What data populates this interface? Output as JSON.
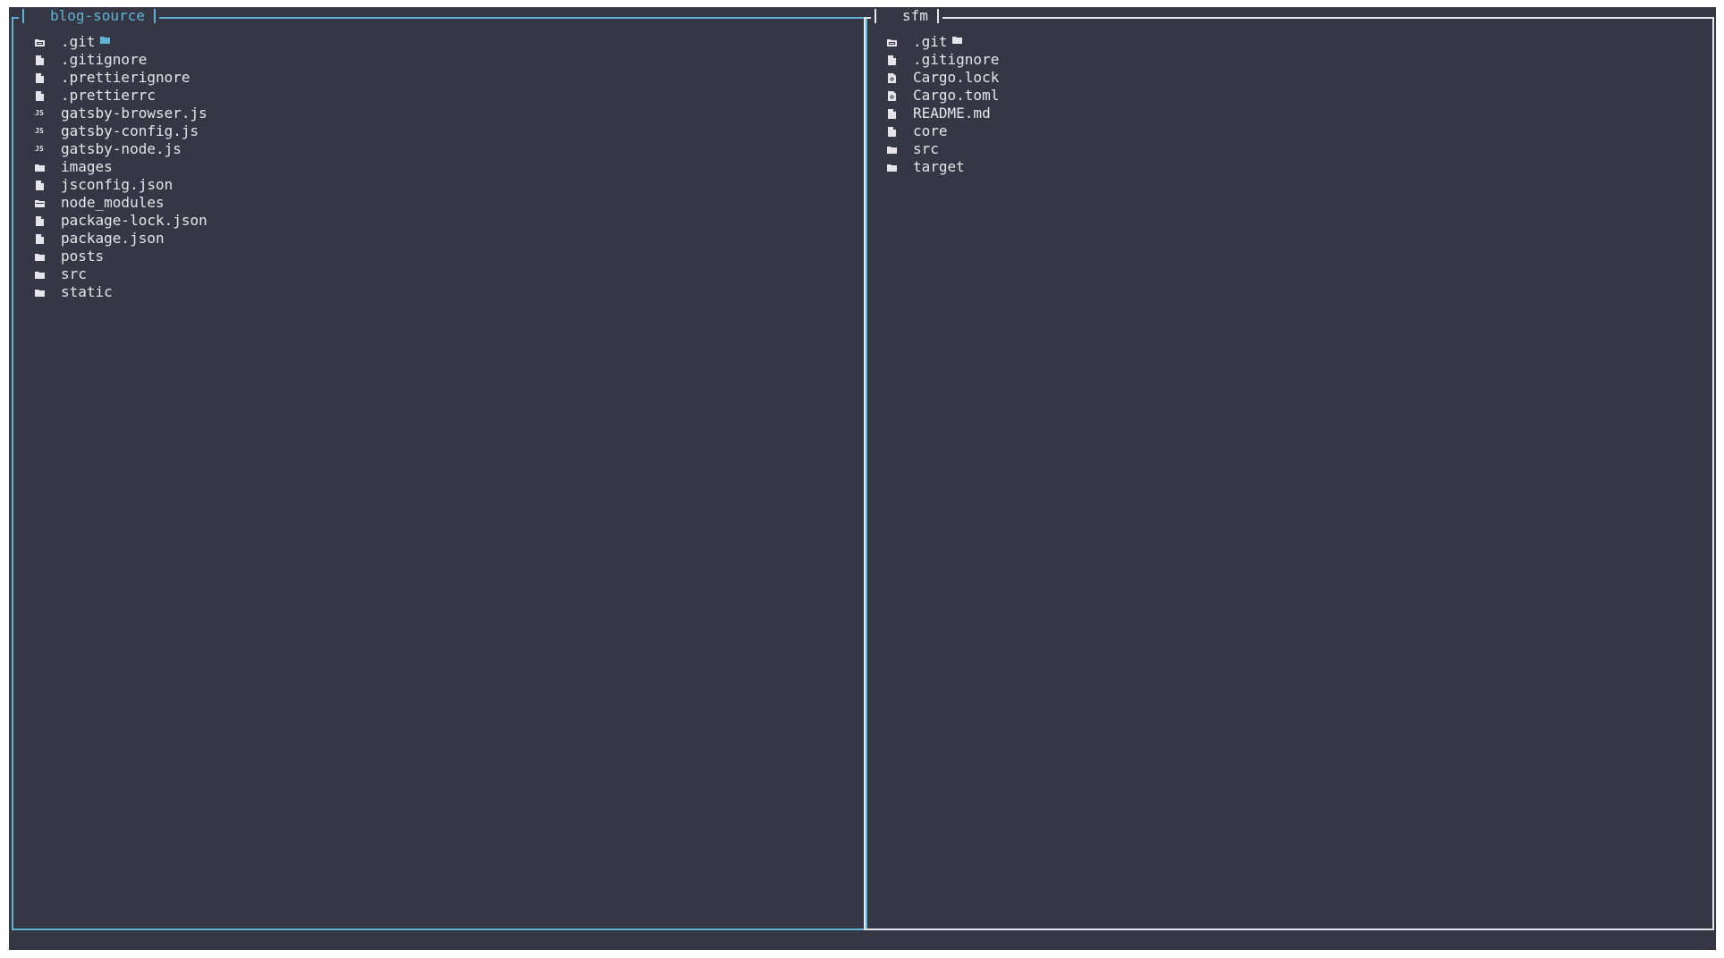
{
  "app": {
    "name": "terminal file manager"
  },
  "colors": {
    "background": "#363744",
    "active_border": "#5fb4d6",
    "inactive_border": "#e6e6ea",
    "text": "#e6e6ea"
  },
  "panes": [
    {
      "title": "blog-source",
      "active": true,
      "entries": [
        {
          "name": ".git",
          "icon": "folder-git-icon"
        },
        {
          "name": ".gitignore",
          "icon": "file-icon"
        },
        {
          "name": ".prettierignore",
          "icon": "file-icon"
        },
        {
          "name": ".prettierrc",
          "icon": "file-icon"
        },
        {
          "name": "gatsby-browser.js",
          "icon": "js-icon"
        },
        {
          "name": "gatsby-config.js",
          "icon": "js-icon"
        },
        {
          "name": "gatsby-node.js",
          "icon": "js-icon"
        },
        {
          "name": "images",
          "icon": "folder-icon"
        },
        {
          "name": "jsconfig.json",
          "icon": "file-icon"
        },
        {
          "name": "node_modules",
          "icon": "folder-npm-icon"
        },
        {
          "name": "package-lock.json",
          "icon": "file-icon"
        },
        {
          "name": "package.json",
          "icon": "file-icon"
        },
        {
          "name": "posts",
          "icon": "folder-icon"
        },
        {
          "name": "src",
          "icon": "folder-icon"
        },
        {
          "name": "static",
          "icon": "folder-icon"
        }
      ]
    },
    {
      "title": "sfm",
      "active": false,
      "entries": [
        {
          "name": ".git",
          "icon": "folder-git-icon"
        },
        {
          "name": ".gitignore",
          "icon": "file-icon"
        },
        {
          "name": "Cargo.lock",
          "icon": "rust-file-icon"
        },
        {
          "name": "Cargo.toml",
          "icon": "rust-file-icon"
        },
        {
          "name": "README.md",
          "icon": "file-icon"
        },
        {
          "name": "core",
          "icon": "file-icon"
        },
        {
          "name": "src",
          "icon": "folder-icon"
        },
        {
          "name": "target",
          "icon": "folder-icon"
        }
      ]
    }
  ]
}
